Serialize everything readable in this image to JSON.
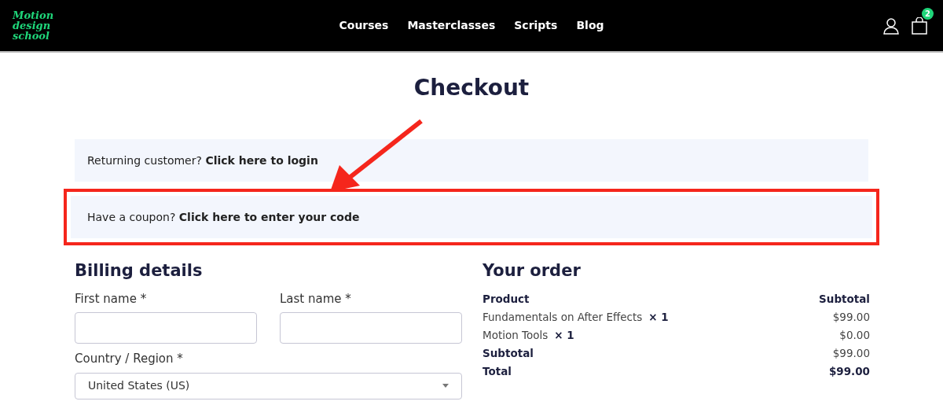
{
  "header": {
    "logo": "Motion design school",
    "nav": [
      {
        "label": "Courses"
      },
      {
        "label": "Masterclasses"
      },
      {
        "label": "Scripts"
      },
      {
        "label": "Blog"
      }
    ],
    "cart_count": "2"
  },
  "title": "Checkout",
  "notices": [
    {
      "text": "Returning customer? **Click here to login**",
      "highlighted": false
    },
    {
      "text": "Have a coupon? **Click here to enter your code**",
      "highlighted": true
    }
  ],
  "billing": {
    "heading": "Billing details",
    "fields": [
      {
        "kind": "input",
        "label": "First name *"
      },
      {
        "kind": "input",
        "label": "Last name *"
      },
      {
        "kind": "select",
        "label": "Country / Region *",
        "value": "United States (US)"
      }
    ]
  },
  "order": {
    "heading": "Your order",
    "columns": [
      "Product",
      "Subtotal"
    ],
    "rows": [
      {
        "kind": "item",
        "name": "Fundamentals on After Effects",
        "qty": "× 1",
        "amount": "$99.00"
      },
      {
        "kind": "item",
        "name": "Motion Tools",
        "qty": "× 1",
        "amount": "$0.00"
      },
      {
        "kind": "subtotal",
        "name": "Subtotal",
        "amount": "$99.00"
      },
      {
        "kind": "total",
        "name": "Total",
        "amount": "$99.00"
      }
    ]
  }
}
